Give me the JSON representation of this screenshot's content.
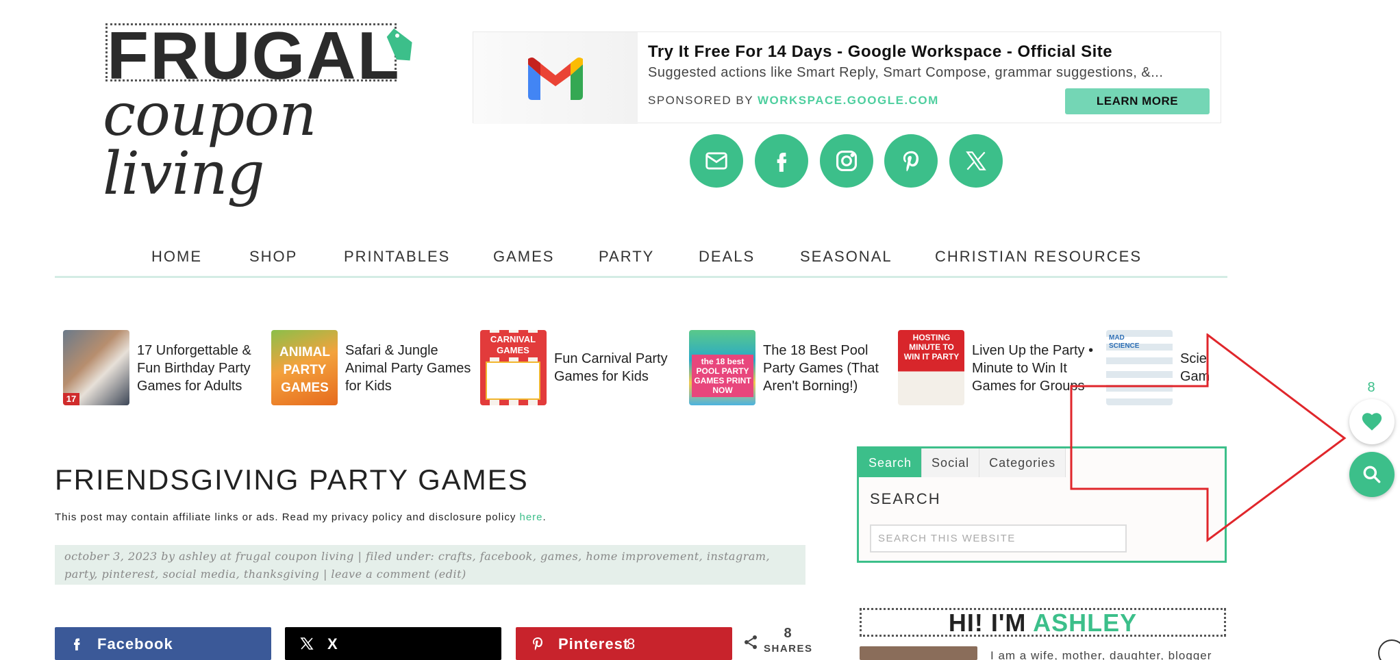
{
  "logo": {
    "top_text": "FRUGAL",
    "bottom_text": "coupon living"
  },
  "ad": {
    "title": "Try It Free For 14 Days - Google Workspace - Official Site",
    "description": "Suggested actions like Smart Reply, Smart Compose, grammar suggestions, &...",
    "sponsored_prefix": "SPONSORED BY ",
    "sponsor_domain": "WORKSPACE.GOOGLE.COM",
    "cta": "LEARN MORE"
  },
  "social": [
    "email-icon",
    "facebook-icon",
    "instagram-icon",
    "pinterest-icon",
    "x-icon"
  ],
  "nav": [
    "HOME",
    "SHOP",
    "PRINTABLES",
    "GAMES",
    "PARTY",
    "DEALS",
    "SEASONAL",
    "CHRISTIAN RESOURCES"
  ],
  "related": [
    {
      "title": "17 Unforgettable & Fun Birthday Party Games for Adults"
    },
    {
      "title": "Safari & Jungle Animal Party Games for Kids"
    },
    {
      "title": "Fun Carnival Party Games for Kids"
    },
    {
      "title": "The 18 Best Pool Party Games (That Aren't Borning!)"
    },
    {
      "title": "Liven Up the Party • Minute to Win It Games for Groups"
    },
    {
      "title": "Scie Gam"
    }
  ],
  "thumb_text": {
    "animal": "ANIMAL PARTY GAMES",
    "carnival": "CARNIVAL GAMES",
    "pool": "the 18 best POOL PARTY GAMES PRINT NOW",
    "minute": "HOSTING MINUTE TO WIN IT PARTY",
    "science": "MAD SCIENCE",
    "birthday_num": "17"
  },
  "post": {
    "title": "FRIENDSGIVING PARTY GAMES",
    "disclosure": "This post may contain affiliate links or ads. Read my privacy policy and disclosure policy ",
    "disclosure_link": "here",
    "disclosure_end": ".",
    "meta_line1": "october 3, 2023 by ashley at frugal coupon living | filed under: crafts, facebook, games, home improvement, instagram,",
    "meta_line2": "party, pinterest, social media, thanksgiving | leave a comment (edit)"
  },
  "share": {
    "facebook": "Facebook",
    "x": "X",
    "pinterest": "Pinterest",
    "pinterest_count": "8",
    "total": "8",
    "total_label": "SHARES"
  },
  "sidebar": {
    "tabs": [
      "Search",
      "Social",
      "Categories"
    ],
    "heading": "SEARCH",
    "search_placeholder": "SEARCH THIS WEBSITE",
    "hi_prefix": "HI! I'M ",
    "hi_name": "ASHLEY",
    "about": "I am a wife, mother, daughter, blogger"
  },
  "floating": {
    "like_count": "8"
  },
  "colors": {
    "accent": "#3cbf8a",
    "facebook": "#3b5998",
    "x": "#000000",
    "pinterest": "#c8232c",
    "arrow": "#e0262b"
  }
}
